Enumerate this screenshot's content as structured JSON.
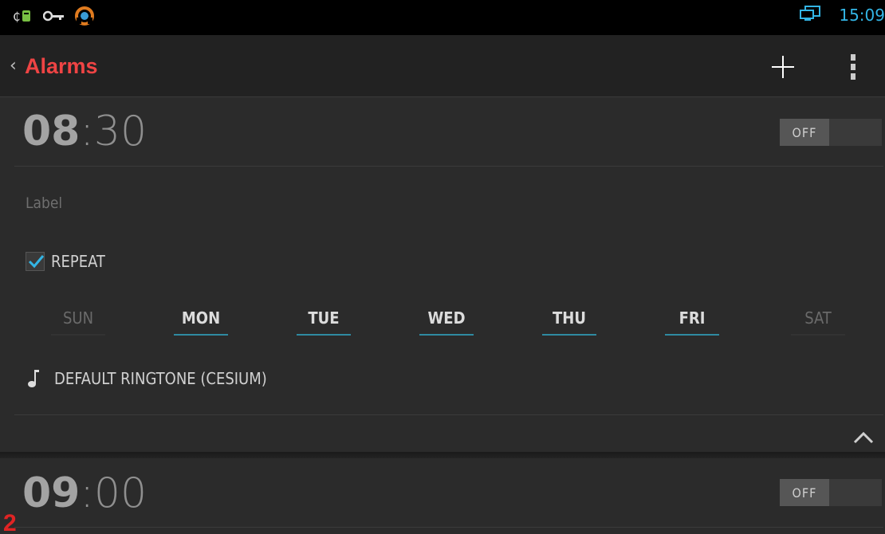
{
  "status_bar": {
    "icons": [
      "usb-debug-icon",
      "key-icon",
      "headset-app-icon"
    ],
    "screen-icon": "screen-mirror-icon",
    "time": "15:09",
    "accent": "#33b5e5"
  },
  "action_bar": {
    "title": "Alarms",
    "title_color": "#ef4444",
    "back_icon": "chevron-left-icon",
    "add_icon": "plus-icon",
    "overflow_icon": "overflow-menu-icon"
  },
  "alarms": [
    {
      "hour": "08",
      "separator": ":",
      "minute": "30",
      "toggle_label": "OFF",
      "label_placeholder": "Label",
      "repeat_label": "REPEAT",
      "repeat_checked": true,
      "days": [
        {
          "label": "SUN",
          "on": false
        },
        {
          "label": "MON",
          "on": true
        },
        {
          "label": "TUE",
          "on": true
        },
        {
          "label": "WED",
          "on": true
        },
        {
          "label": "THU",
          "on": true
        },
        {
          "label": "FRI",
          "on": true
        },
        {
          "label": "SAT",
          "on": false
        }
      ],
      "ringtone": "DEFAULT RINGTONE (CESIUM)",
      "collapse_icon": "chevron-up-icon"
    },
    {
      "hour": "09",
      "separator": ":",
      "minute": "00",
      "toggle_label": "OFF"
    }
  ],
  "badge": "2"
}
